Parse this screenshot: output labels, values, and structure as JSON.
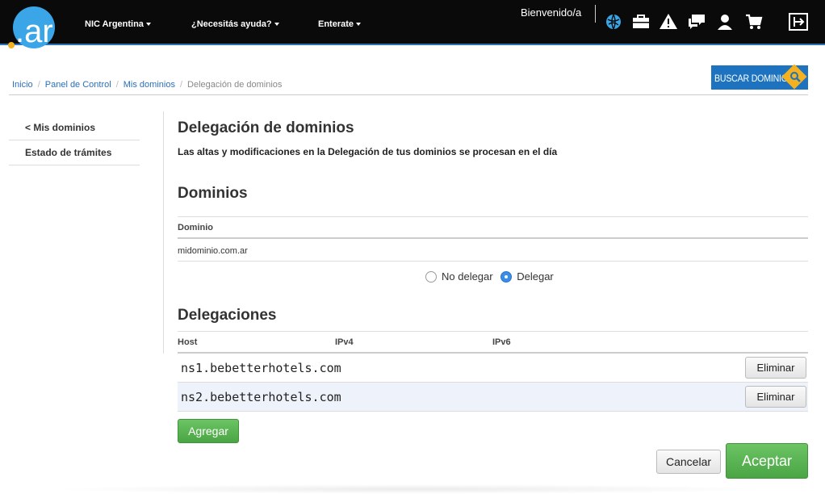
{
  "header": {
    "logo_text": "ar",
    "nav": [
      {
        "label": "NIC Argentina"
      },
      {
        "label": "¿Necesitás ayuda?"
      },
      {
        "label": "Enterate"
      }
    ],
    "welcome": "Bienvenido/a",
    "icons": [
      "globe-icon",
      "briefcase-icon",
      "warning-icon",
      "chat-icon",
      "user-icon",
      "cart-icon",
      "logout-icon"
    ]
  },
  "breadcrumb": {
    "items": [
      "Inicio",
      "Panel de Control",
      "Mis dominios"
    ],
    "current": "Delegación de dominios"
  },
  "buscar_label": "BUSCAR DOMINIOS",
  "sidebar": {
    "items": [
      {
        "label": "< Mis dominios"
      },
      {
        "label": "Estado de trámites"
      }
    ]
  },
  "main": {
    "title": "Delegación de dominios",
    "subtitle": "Las altas y modificaciones en la Delegación de tus dominios se procesan en el día",
    "dominios": {
      "heading": "Dominios",
      "column": "Dominio",
      "value": "midominio.com.ar",
      "options": [
        "No delegar",
        "Delegar"
      ],
      "selected": "Delegar"
    },
    "delegaciones": {
      "heading": "Delegaciones",
      "columns": [
        "Host",
        "IPv4",
        "IPv6"
      ],
      "rows": [
        {
          "host": "ns1.bebetterhotels.com",
          "action": "Eliminar"
        },
        {
          "host": "ns2.bebetterhotels.com",
          "action": "Eliminar"
        }
      ],
      "add_label": "Agregar"
    }
  },
  "footer": {
    "cancel_label": "Cancelar",
    "accept_label": "Aceptar"
  },
  "colors": {
    "topbar": "#0a0a0a",
    "accent_blue": "#1d73bf",
    "green": "#4aa544",
    "radio_selected": "#3a8ee6"
  }
}
